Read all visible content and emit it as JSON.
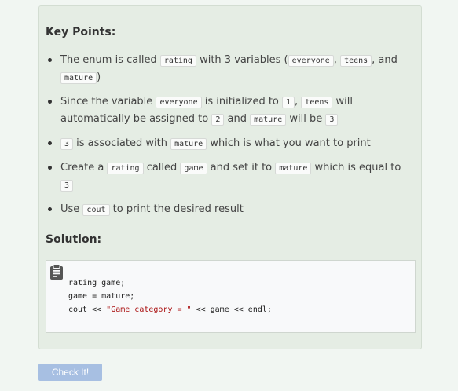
{
  "key_points": {
    "heading": "Key Points:",
    "items": [
      {
        "t1": "The enum is called ",
        "c1": "rating",
        "t2": " with 3 variables (",
        "c2": "everyone",
        "t3": ", ",
        "c3": "teens",
        "t4": ", and ",
        "c4": "mature",
        "t5": ")"
      },
      {
        "t1": "Since the variable ",
        "c1": "everyone",
        "t2": " is initialized to ",
        "c2": "1",
        "t3": ", ",
        "c3": "teens",
        "t4": " will automatically be assigned to ",
        "c4": "2",
        "t5": " and ",
        "c5": "mature",
        "t6": " will be ",
        "c6": "3"
      },
      {
        "c1": "3",
        "t1": " is associated with ",
        "c2": "mature",
        "t2": " which is what you want to print"
      },
      {
        "t1": "Create a ",
        "c1": "rating",
        "t2": " called ",
        "c2": "game",
        "t3": " and set it to ",
        "c3": "mature",
        "t4": " which is equal to ",
        "c4": "3"
      },
      {
        "t1": "Use ",
        "c1": "cout",
        "t2": " to print the desired result"
      }
    ]
  },
  "solution": {
    "heading": "Solution:",
    "clipboard_icon": "clipboard-icon",
    "line1": "rating game;",
    "line2": "game = mature;",
    "line3_pre": "cout << ",
    "line3_str": "\"Game category = \"",
    "line3_post": " << game << endl;"
  },
  "check_button": {
    "label": "Check It!"
  },
  "colors": {
    "panel_bg": "#e5ede4",
    "button_bg": "#a7bfe2",
    "string_literal": "#a11"
  }
}
